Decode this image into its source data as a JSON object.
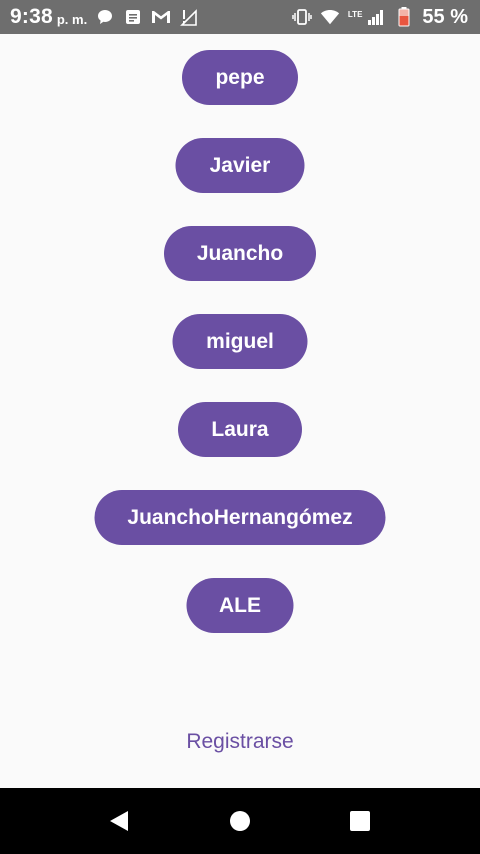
{
  "status_bar": {
    "time": "9:38",
    "ampm": "p. m.",
    "battery": "55 %",
    "network": "LTE"
  },
  "users": [
    {
      "name": "pepe"
    },
    {
      "name": "Javier"
    },
    {
      "name": "Juancho"
    },
    {
      "name": "miguel"
    },
    {
      "name": "Laura"
    },
    {
      "name": "JuanchoHernangómez"
    },
    {
      "name": "ALE"
    }
  ],
  "register_label": "Registrarse",
  "colors": {
    "accent": "#6a4fa3",
    "status_bar": "#6e6e6e",
    "background": "#fafafa",
    "nav_bar": "#000000"
  }
}
